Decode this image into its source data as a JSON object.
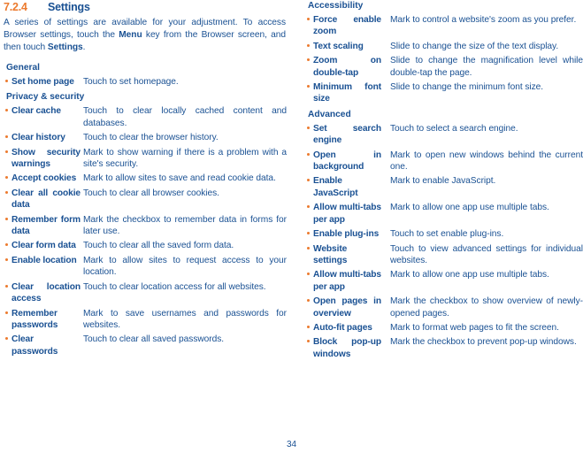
{
  "heading": {
    "number": "7.2.4",
    "title": "Settings"
  },
  "intro": {
    "part1": "A series of settings are available for your adjustment. To access Browser settings, touch the ",
    "bold1": "Menu",
    "part2": " key from the Browser screen, and then touch ",
    "bold2": "Settings",
    "part3": "."
  },
  "left_column": {
    "sections": [
      {
        "title": "General",
        "items": [
          {
            "term": "Set home page",
            "desc": "Touch to set homepage."
          }
        ]
      },
      {
        "title": "Privacy & security",
        "items": [
          {
            "term": "Clear cache",
            "desc": "Touch to clear locally cached content and databases."
          },
          {
            "term": "Clear history",
            "desc": "Touch to clear the browser history."
          },
          {
            "term": "Show security warnings",
            "desc": "Mark to show warning if there is a problem with a site's security."
          },
          {
            "term": "Accept cookies",
            "desc": "Mark to allow sites to save and read cookie data."
          },
          {
            "term": "Clear all cookie data",
            "desc": "Touch to clear all browser cookies."
          },
          {
            "term": "Remember form data",
            "desc": "Mark the checkbox to remember data in forms for later use."
          },
          {
            "term": "Clear form data",
            "desc": "Touch to clear all the saved form data."
          },
          {
            "term": "Enable location",
            "desc": "Mark to allow sites to request access to your location."
          },
          {
            "term": "Clear location access",
            "desc": "Touch to clear location access for all websites."
          },
          {
            "term": "Remember passwords",
            "desc": "Mark to save usernames and passwords for websites."
          },
          {
            "term": "Clear passwords",
            "desc": "Touch to clear all saved passwords."
          }
        ]
      }
    ]
  },
  "right_column": {
    "sections": [
      {
        "title": "Accessibility",
        "items": [
          {
            "term": "Force enable zoom",
            "desc": "Mark to control a website's zoom as you prefer."
          },
          {
            "term": "Text scaling",
            "desc": "Slide to change the size of the text display."
          },
          {
            "term": "Zoom on double-tap",
            "desc": "Slide to change the magnification level while double-tap the page."
          },
          {
            "term": "Minimum font size",
            "desc": "Slide to change the minimum font size."
          }
        ]
      },
      {
        "title": "Advanced",
        "items": [
          {
            "term": "Set search engine",
            "desc": "Touch to select a search engine."
          },
          {
            "term": "Open in background",
            "desc": "Mark to open new windows behind the current one."
          },
          {
            "term": "Enable JavaScript",
            "desc": "Mark to enable JavaScript."
          },
          {
            "term": "Allow multi-tabs per app",
            "desc": "Mark to allow one app use multiple tabs."
          },
          {
            "term": "Enable plug-ins",
            "desc": "Touch to set enable plug-ins."
          },
          {
            "term": "Website settings",
            "desc": "Touch to view advanced settings for individual websites."
          },
          {
            "term": "Allow multi-tabs per app",
            "desc": "Mark to allow one app use multiple tabs."
          },
          {
            "term": "Open pages in overview",
            "desc": "Mark the checkbox to show overview of newly-opened pages."
          },
          {
            "term": "Auto-fit pages",
            "desc": "Mark to format web pages to fit the screen."
          },
          {
            "term": "Block pop-up windows",
            "desc": "Mark the checkbox to prevent pop-up windows."
          }
        ]
      }
    ]
  },
  "footer": {
    "page_number": "34"
  },
  "colors": {
    "accent_orange": "#ec7a2e",
    "text_blue": "#1a5193",
    "background": "#ffffff"
  }
}
